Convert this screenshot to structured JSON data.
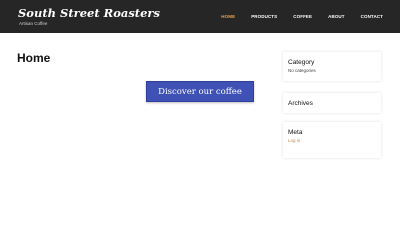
{
  "site": {
    "name": "South Street Roasters",
    "tagline": "Artisan Coffee"
  },
  "nav": {
    "items": [
      {
        "label": "HOME",
        "active": true
      },
      {
        "label": "PRODUCTS",
        "active": false
      },
      {
        "label": "COFFEE",
        "active": false
      },
      {
        "label": "ABOUT",
        "active": false
      },
      {
        "label": "CONTACT",
        "active": false
      }
    ]
  },
  "main": {
    "title": "Home",
    "cta_label": "Discover our coffee"
  },
  "sidebar": {
    "category": {
      "title": "Category",
      "text": "No categories"
    },
    "archives": {
      "title": "Archives"
    },
    "meta": {
      "title": "Meta",
      "link": "Log in"
    }
  },
  "colors": {
    "header_bg": "#262626",
    "nav_active": "#e8a14a",
    "cta_bg": "#3f51b5",
    "link": "#b98b54"
  }
}
